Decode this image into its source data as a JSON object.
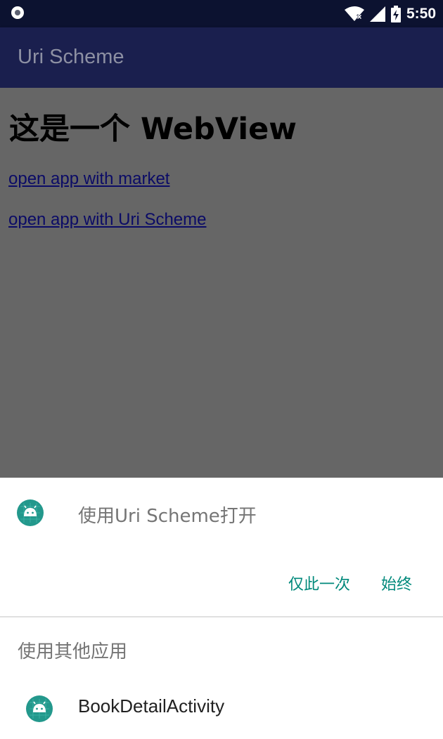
{
  "status_bar": {
    "time": "5:50",
    "icons": [
      "notification-dot-icon",
      "wifi-icon",
      "cell-signal-icon",
      "battery-charging-icon"
    ]
  },
  "app_bar": {
    "title": "Uri Scheme",
    "background": "#1a1f4e"
  },
  "webview": {
    "heading": "这是一个 WebView",
    "links": [
      "open app with market",
      "open app with Uri Scheme"
    ],
    "background": "#666666"
  },
  "chooser": {
    "title": "使用Uri Scheme打开",
    "buttons": {
      "once": "仅此一次",
      "always": "始终"
    },
    "other_apps_label": "使用其他应用",
    "apps": [
      {
        "label": "BookDetailActivity",
        "icon": "android-app-icon"
      }
    ],
    "accent": "#00897b"
  }
}
